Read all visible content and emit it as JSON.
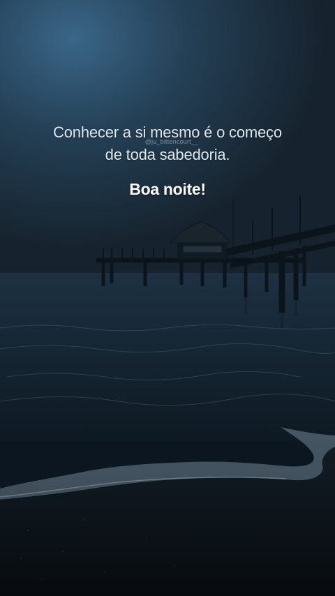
{
  "quote": {
    "line1": "Conhecer a si mesmo é o começo",
    "line2": "de toda sabedoria."
  },
  "watermark": "@ju_bittencourt__",
  "greeting": "Boa noite!",
  "colors": {
    "sky_top": "#2a4c6e",
    "sky_bottom": "#1b2c3a",
    "sea": "#142430",
    "sand": "#0c1318",
    "text": "#dfe7ee",
    "greeting": "#ffffff"
  }
}
